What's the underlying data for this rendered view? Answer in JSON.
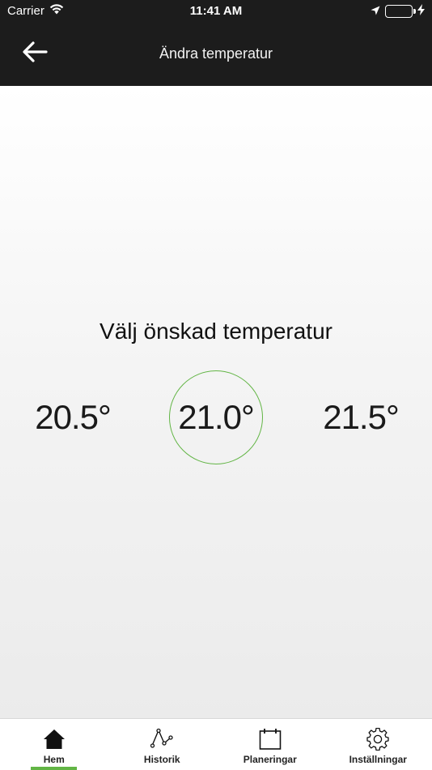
{
  "status_bar": {
    "carrier": "Carrier",
    "time": "11:41 AM",
    "battery_color": "#4cd964"
  },
  "header": {
    "title": "Ändra temperatur",
    "back_icon": "arrow-left-icon"
  },
  "main": {
    "prompt": "Välj önskad temperatur",
    "temperatures": [
      {
        "label": "20.5°",
        "selected": false
      },
      {
        "label": "21.0°",
        "selected": true
      },
      {
        "label": "21.5°",
        "selected": false
      }
    ],
    "selected_color": "#62b545"
  },
  "tabs": [
    {
      "label": "Hem",
      "icon": "home-icon",
      "active": true
    },
    {
      "label": "Historik",
      "icon": "history-graph-icon",
      "active": false
    },
    {
      "label": "Planeringar",
      "icon": "calendar-icon",
      "active": false
    },
    {
      "label": "Inställningar",
      "icon": "gear-icon",
      "active": false
    }
  ],
  "colors": {
    "header_bg": "#1c1c1c",
    "accent": "#62b545"
  }
}
